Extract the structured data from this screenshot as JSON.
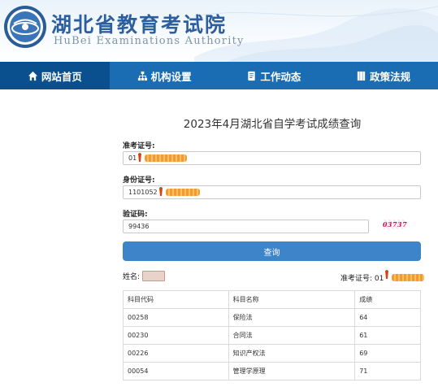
{
  "header": {
    "title": "湖北省教育考试院",
    "subtitle": "HuBei Examinations Authority"
  },
  "nav": {
    "items": [
      {
        "label": "网站首页",
        "icon": "home-icon",
        "active": true
      },
      {
        "label": "机构设置",
        "icon": "org-chart-icon",
        "active": false
      },
      {
        "label": "工作动态",
        "icon": "document-icon",
        "active": false
      },
      {
        "label": "政策法规",
        "icon": "book-icon",
        "active": false
      }
    ]
  },
  "form": {
    "title": "2023年4月湖北省自学考试成绩查询",
    "admission_label": "准考证号:",
    "admission_value": "01",
    "id_label": "身份证号:",
    "id_value": "1101052",
    "captcha_label": "验证码:",
    "captcha_value": "99436",
    "captcha_image_text": "03737",
    "submit_label": "查询"
  },
  "result": {
    "name_label": "姓名:",
    "exam_no_label": "准考证号:",
    "exam_no_prefix": "01",
    "table": {
      "headers": [
        "科目代码",
        "科目名称",
        "成绩"
      ],
      "rows": [
        [
          "00258",
          "保险法",
          "64"
        ],
        [
          "00230",
          "合同法",
          "61"
        ],
        [
          "00226",
          "知识产权法",
          "69"
        ],
        [
          "00054",
          "管理学原理",
          "71"
        ]
      ]
    }
  },
  "colors": {
    "nav_bg": "#1a6db3",
    "nav_active": "#0a4f8e",
    "button_bg": "#3d84c8",
    "title_blue": "#2d5fa0",
    "redaction": "#f59a2e"
  }
}
